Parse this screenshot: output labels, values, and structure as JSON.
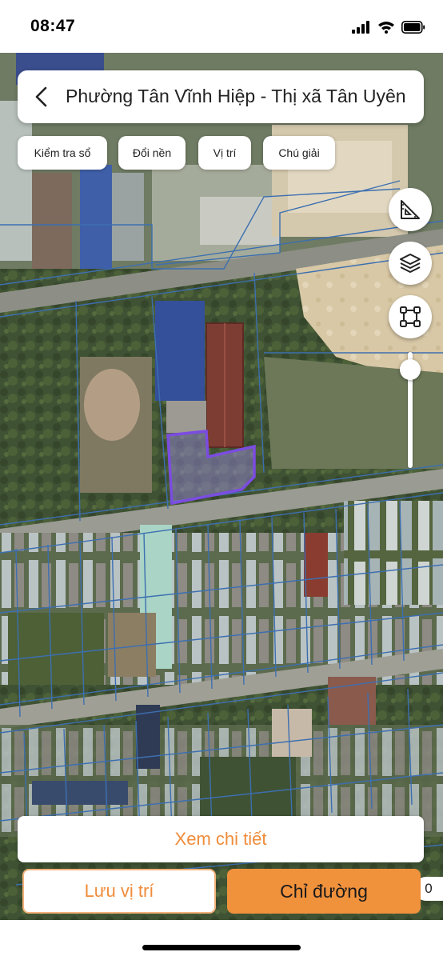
{
  "status_bar": {
    "time": "08:47"
  },
  "header": {
    "title": "Phường Tân Vĩnh Hiệp - Thị xã Tân Uyên"
  },
  "chips": [
    {
      "label": "Kiểm tra sổ"
    },
    {
      "label": "Đổi nền"
    },
    {
      "label": "Vị trí"
    },
    {
      "label": "Chú giải"
    }
  ],
  "map_tools": [
    "ruler-icon",
    "layers-icon",
    "select-area-icon"
  ],
  "zoom_level": 0.15,
  "actions": {
    "detail_label": "Xem chi tiết",
    "save_label": "Lưu vị trí",
    "directions_label": "Chỉ đường"
  },
  "badge": {
    "count": "0"
  },
  "colors": {
    "accent": "#f0913c",
    "accent_text": "#f08c3a",
    "parcel_lines": "#3d6fb0",
    "selected_parcel": "#7b4ce0"
  }
}
